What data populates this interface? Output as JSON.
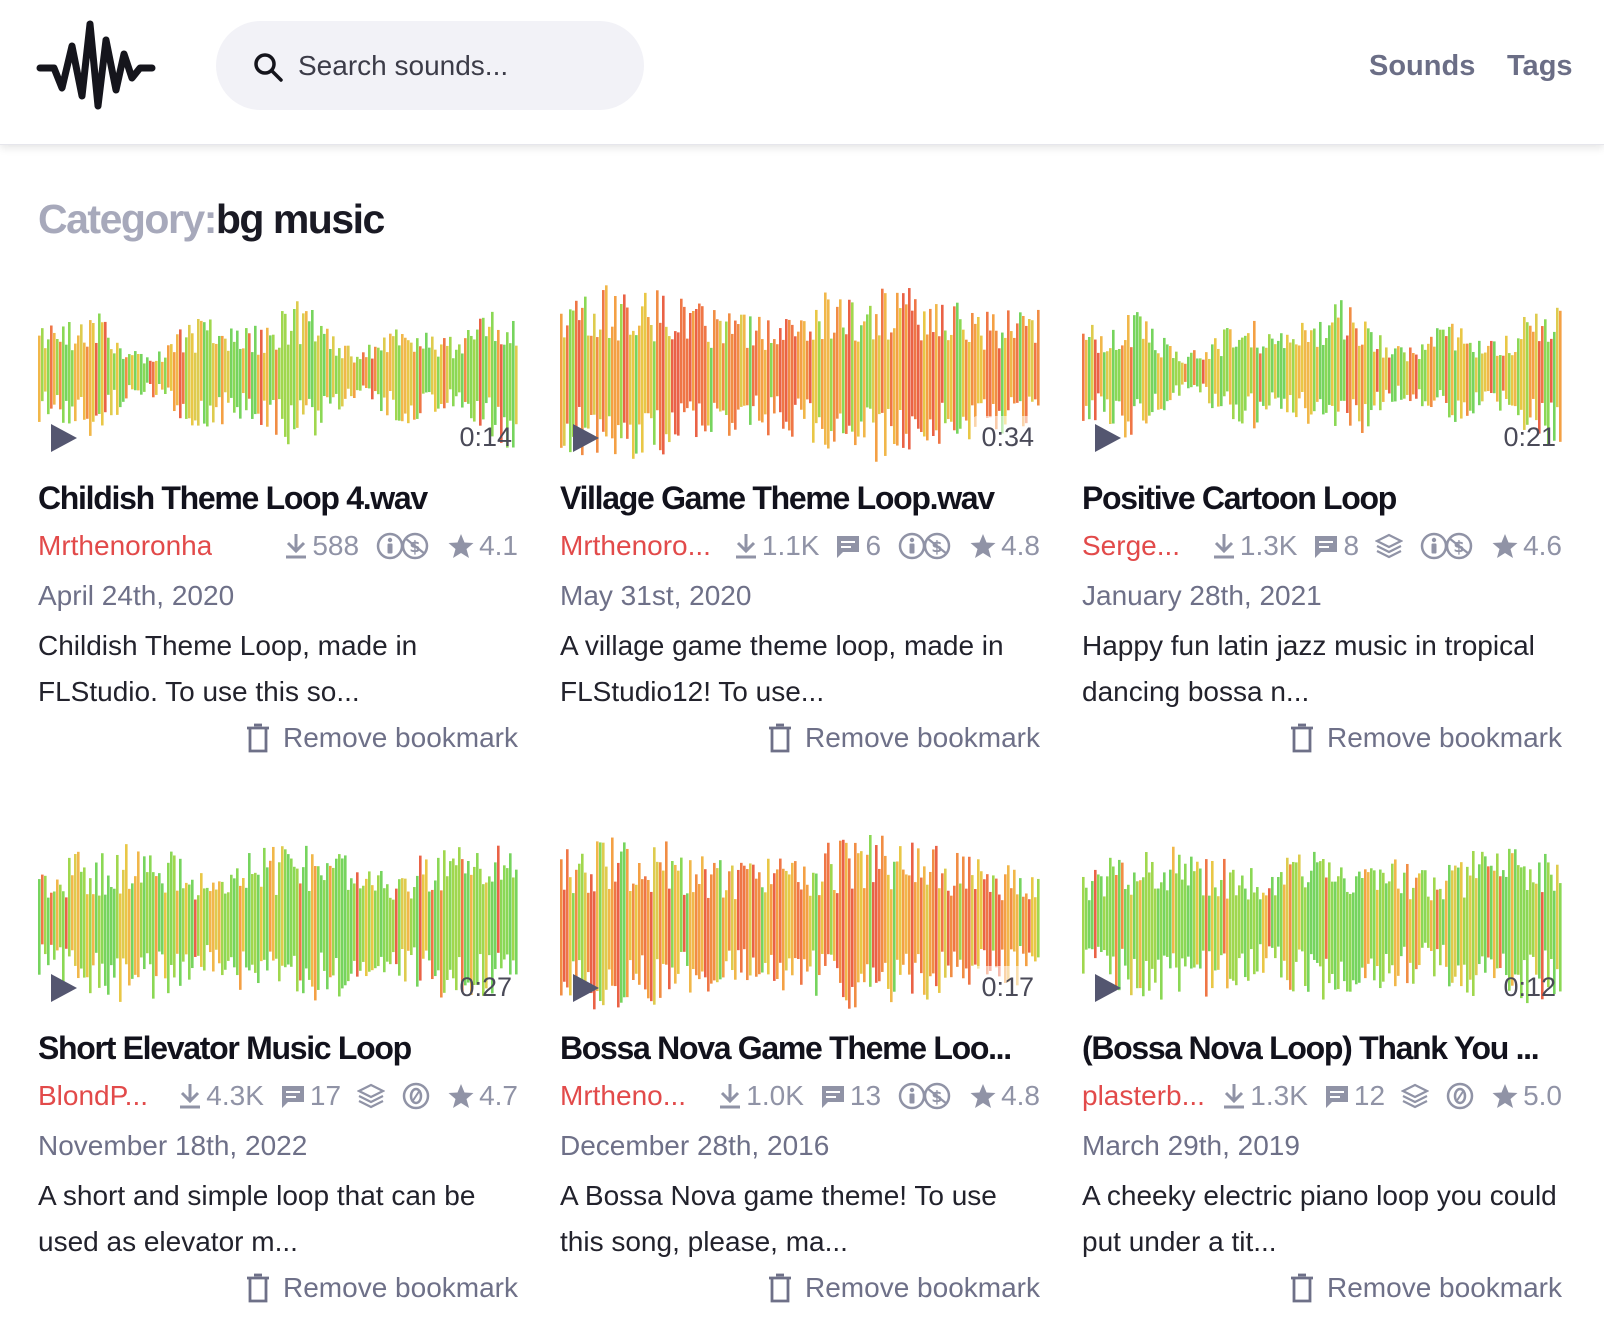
{
  "header": {
    "logo_icon": "waveform-logo-icon",
    "search": {
      "icon": "search-icon",
      "placeholder": "Search sounds..."
    },
    "nav": [
      {
        "label": "Sounds"
      },
      {
        "label": "Tags"
      }
    ]
  },
  "page": {
    "title_label": "Category:",
    "title_value": "bg music"
  },
  "colors": {
    "accent_author": "#e24a4a",
    "wave_green": "#6fd255",
    "wave_yellow": "#e8c43c",
    "wave_orange": "#f0873a",
    "muted": "#6e7088"
  },
  "cards": [
    {
      "duration": "0:14",
      "title": "Childish Theme Loop 4.wav",
      "author": "Mrthenoronha",
      "downloads": "588",
      "comments": "",
      "has_layers": false,
      "license_icon": "cc-by-nc-icon",
      "rating": "4.1",
      "date": "April 24th, 2020",
      "description": "Childish Theme Loop, made in FLStudio. To use this so...",
      "remove_label": "Remove bookmark"
    },
    {
      "duration": "0:34",
      "title": "Village Game Theme Loop.wav",
      "author": "Mrthenoro...",
      "downloads": "1.1K",
      "comments": "6",
      "has_layers": false,
      "license_icon": "cc-by-nc-icon",
      "rating": "4.8",
      "date": "May 31st, 2020",
      "description": "A village game theme loop, made in FLStudio12! To use...",
      "remove_label": "Remove bookmark"
    },
    {
      "duration": "0:21",
      "title": "Positive Cartoon Loop",
      "author": "Serge...",
      "downloads": "1.3K",
      "comments": "8",
      "has_layers": true,
      "license_icon": "cc-by-nc-icon",
      "rating": "4.6",
      "date": "January 28th, 2021",
      "description": "Happy fun latin jazz music in tropical dancing bossa n...",
      "remove_label": "Remove bookmark"
    },
    {
      "duration": "0:27",
      "title": "Short Elevator Music Loop",
      "author": "BlondP...",
      "downloads": "4.3K",
      "comments": "17",
      "has_layers": true,
      "license_icon": "cc-zero-icon",
      "rating": "4.7",
      "date": "November 18th, 2022",
      "description": "A short and simple loop that can be used as elevator m...",
      "remove_label": "Remove bookmark"
    },
    {
      "duration": "0:17",
      "title": "Bossa Nova Game Theme Loo...",
      "author": "Mrtheno...",
      "downloads": "1.0K",
      "comments": "13",
      "has_layers": false,
      "license_icon": "cc-by-nc-icon",
      "rating": "4.8",
      "date": "December 28th, 2016",
      "description": "A Bossa Nova game theme! To use this song, please, ma...",
      "remove_label": "Remove bookmark"
    },
    {
      "duration": "0:12",
      "title": "(Bossa Nova Loop) Thank You ...",
      "author": "plasterb...",
      "downloads": "1.3K",
      "comments": "12",
      "has_layers": true,
      "license_icon": "cc-zero-icon",
      "rating": "5.0",
      "date": "March 29th, 2019",
      "description": "A cheeky electric piano loop you could put under a tit...",
      "remove_label": "Remove bookmark"
    }
  ]
}
